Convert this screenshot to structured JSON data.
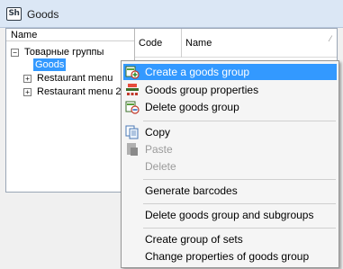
{
  "window": {
    "title": "Goods",
    "icon": "app-logo-icon",
    "icon_text": "Sh"
  },
  "tree": {
    "header": "Name",
    "items": [
      {
        "label": "Товарные группы",
        "expander": "−",
        "level": 0
      },
      {
        "label": "Goods",
        "expander": "",
        "level": 1,
        "selected": true
      },
      {
        "label": "Restaurant menu",
        "expander": "+",
        "level": 1
      },
      {
        "label": "Restaurant menu 2",
        "expander": "+",
        "level": 1
      }
    ]
  },
  "grid": {
    "columns": [
      "Code",
      "Name"
    ],
    "sort_indicator": "⁄"
  },
  "context_menu": {
    "items": [
      {
        "label": "Create a goods group",
        "icon": "create-group-icon",
        "hovered": true,
        "disabled": false
      },
      {
        "label": "Goods group properties",
        "icon": "group-properties-icon",
        "disabled": false
      },
      {
        "label": "Delete goods group",
        "icon": "delete-group-icon",
        "disabled": false
      },
      {
        "label": "Copy",
        "icon": "copy-icon",
        "disabled": false
      },
      {
        "label": "Paste",
        "icon": "paste-icon",
        "disabled": true
      },
      {
        "label": "Delete",
        "icon": "",
        "disabled": true
      },
      {
        "label": "Generate barcodes",
        "icon": "",
        "disabled": false
      },
      {
        "label": "Delete goods group and subgroups",
        "icon": "",
        "disabled": false
      },
      {
        "label": "Create group of sets",
        "icon": "",
        "disabled": false
      },
      {
        "label": "Change properties of goods group",
        "icon": "",
        "disabled": false
      }
    ]
  },
  "colors": {
    "selection": "#3399ff",
    "titlebar": "#dbe7f5",
    "menu_bg": "#f5f5f5"
  }
}
